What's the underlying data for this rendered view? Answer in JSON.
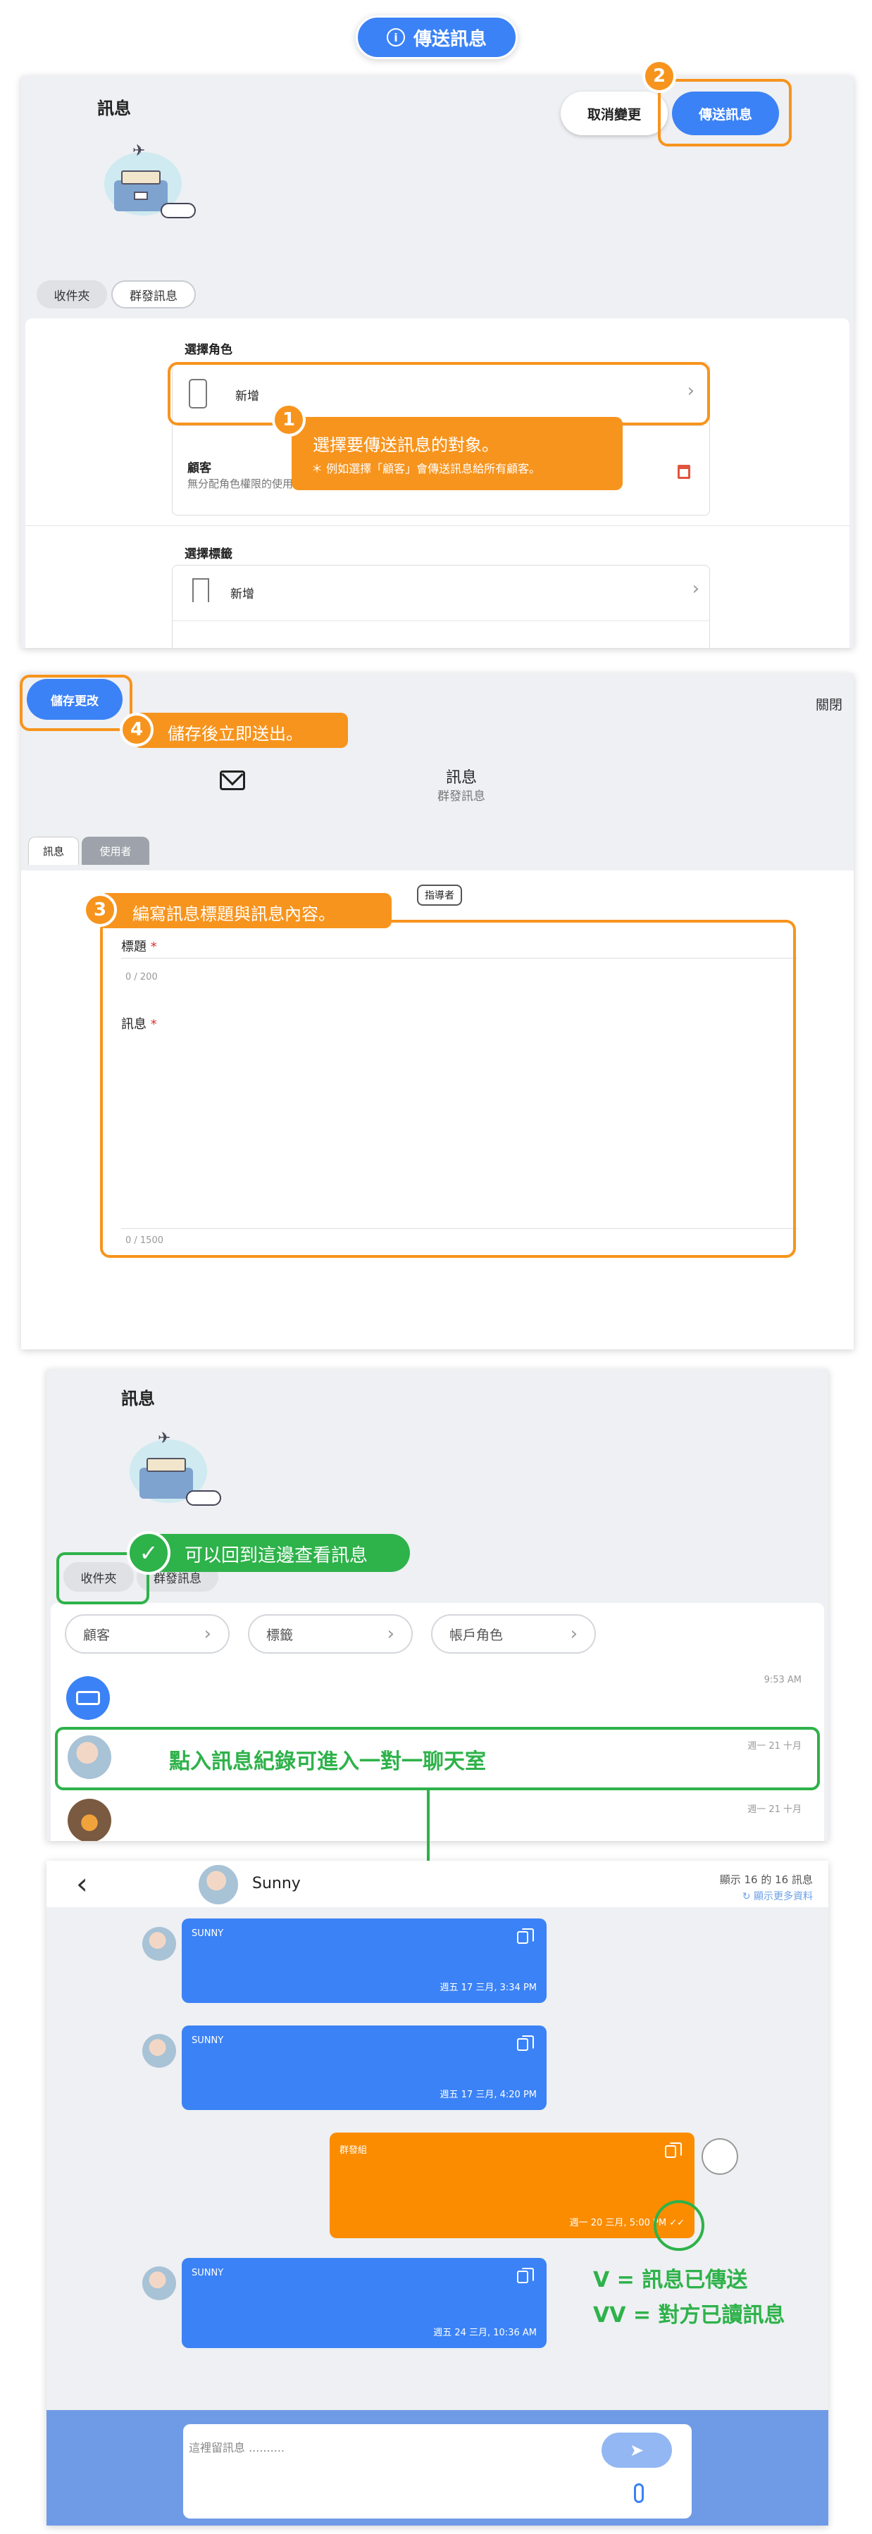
{
  "top_button": {
    "label": "傳送訊息"
  },
  "panel1": {
    "title": "訊息",
    "cancel_label": "取消變更",
    "send_label": "傳送訊息",
    "tabs": [
      "收件夾",
      "群發訊息"
    ],
    "select_role_label": "選擇角色",
    "add_label": "新增",
    "customer_title": "顧客",
    "customer_sub": "無分配角色權限的使用者",
    "select_tag_label": "選擇標籤",
    "add_tag_label": "新增"
  },
  "callout1": {
    "number": "1",
    "title": "選擇要傳送訊息的對象。",
    "sub": "＊ 例如選擇「顧客」會傳送訊息給所有顧客。"
  },
  "callout2": {
    "number": "2"
  },
  "panel2": {
    "save_label": "儲存更改",
    "close_label": "關閉",
    "heading": "訊息",
    "subheading": "群發訊息",
    "tabs": [
      "訊息",
      "使用者"
    ],
    "guide_label": "指導者",
    "title_label": "標題",
    "title_count": "0 / 200",
    "message_label": "訊息",
    "message_count": "0 / 1500",
    "required_mark": "*"
  },
  "callout3": {
    "number": "3",
    "text": "編寫訊息標題與訊息內容。"
  },
  "callout4": {
    "number": "4",
    "text": "儲存後立即送出。"
  },
  "panel3": {
    "title": "訊息",
    "tabs": [
      "收件夾",
      "群發訊息"
    ],
    "filters": [
      "顧客",
      "標籤",
      "帳戶角色"
    ],
    "rows": [
      {
        "time": "9:53 AM"
      },
      {
        "time": "週一 21 十月"
      },
      {
        "time": "週一 21 十月"
      }
    ]
  },
  "callout_green1": {
    "text": "可以回到這邊查看訊息"
  },
  "callout_green2": {
    "text": "點入訊息紀錄可進入一對一聊天室"
  },
  "chat": {
    "back": "‹",
    "name": "Sunny",
    "count": "顯示 16 的 16 訊息",
    "more": "顯示更多資料",
    "messages": [
      {
        "sender": "SUNNY",
        "time": "週五 17 三月, 3:34 PM",
        "color": "#3b82f6"
      },
      {
        "sender": "SUNNY",
        "time": "週五 17 三月, 4:20 PM",
        "color": "#3b82f6"
      },
      {
        "sender": "群發組",
        "time": "週一 20 三月, 5:00 PM ✓✓",
        "color": "#fb8c00"
      },
      {
        "sender": "SUNNY",
        "time": "週五 24 三月, 10:36 AM",
        "color": "#3b82f6"
      }
    ],
    "input_placeholder": "這裡留訊息 ..........",
    "legend_v": "V  =  訊息已傳送",
    "legend_vv": "VV  =  對方已讀訊息"
  },
  "colors": {
    "orange": "#f7941d",
    "green": "#2eb24a",
    "blue": "#3b82f6"
  }
}
